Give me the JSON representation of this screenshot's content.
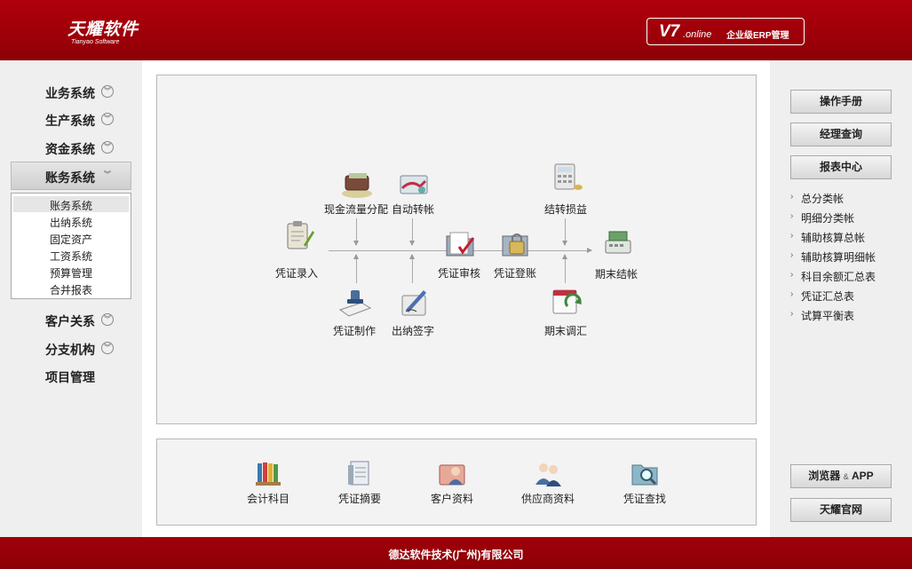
{
  "header": {
    "logo_main": "天耀软件",
    "logo_sub": "Tianyao Software",
    "version_main": "V7",
    "version_online": ".online",
    "version_desc": "企业级ERP管理"
  },
  "leftnav": {
    "items": [
      {
        "label": "业务系统"
      },
      {
        "label": "生产系统"
      },
      {
        "label": "资金系统"
      },
      {
        "label": "账务系统"
      },
      {
        "label": "客户关系"
      },
      {
        "label": "分支机构"
      },
      {
        "label": "项目管理"
      }
    ],
    "subitems": [
      {
        "label": "账务系统"
      },
      {
        "label": "出纳系统"
      },
      {
        "label": "固定资产"
      },
      {
        "label": "工资系统"
      },
      {
        "label": "预算管理"
      },
      {
        "label": "合并报表"
      }
    ]
  },
  "flow": {
    "voucher_entry": "凭证录入",
    "cash_flow": "现金流量分配",
    "auto_transfer": "自动转帐",
    "voucher_make": "凭证制作",
    "cashier_sign": "出纳签字",
    "voucher_audit": "凭证审核",
    "voucher_post": "凭证登账",
    "profit_transfer": "结转损益",
    "period_adjust": "期末调汇",
    "period_close": "期末结帐"
  },
  "quick": [
    {
      "label": "会计科目"
    },
    {
      "label": "凭证摘要"
    },
    {
      "label": "客户资料"
    },
    {
      "label": "供应商资料"
    },
    {
      "label": "凭证查找"
    }
  ],
  "rightnav": {
    "manual": "操作手册",
    "manager_query": "经理查询",
    "report_center": "报表中心",
    "links": [
      {
        "label": "总分类帐"
      },
      {
        "label": "明细分类帐"
      },
      {
        "label": "辅助核算总帐"
      },
      {
        "label": "辅助核算明细帐"
      },
      {
        "label": "科目余额汇总表"
      },
      {
        "label": "凭证汇总表"
      },
      {
        "label": "试算平衡表"
      }
    ],
    "browser": "浏览器",
    "browser_amp": "&",
    "browser_app": "APP",
    "official": "天耀官网"
  },
  "footer": {
    "text": "德达软件技术(广州)有限公司"
  },
  "colors": {
    "brand": "#9a0008",
    "panel": "#f3f3f3"
  }
}
